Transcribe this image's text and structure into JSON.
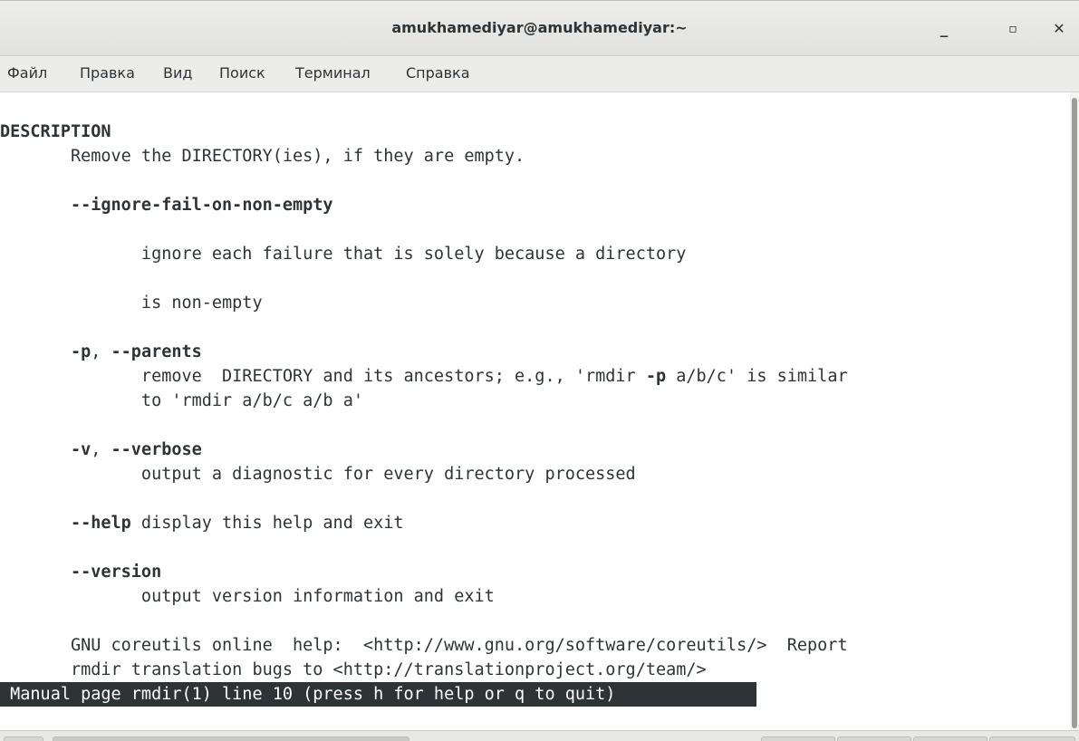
{
  "window": {
    "title": "amukhamediyar@amukhamediyar:~",
    "controls": {
      "minimize": "_",
      "maximize": "▫",
      "close": "✕"
    }
  },
  "menu": {
    "items": [
      "Файл",
      "Правка",
      "Вид",
      "Поиск",
      "Терминал",
      "Справка"
    ]
  },
  "terminal": {
    "lines": {
      "l1": "DESCRIPTION",
      "l2": "       Remove the DIRECTORY(ies), if they are empty.",
      "l3_opt": "--ignore-fail-on-non-empty",
      "l4": "              ignore each failure that is solely because a directory",
      "l5": "              is non-empty",
      "l6_opt1": "-p",
      "l6_sep": ", ",
      "l6_opt2": "--parents",
      "l7_pre": "              remove  DIRECTORY and its ancestors; e.g., 'rmdir ",
      "l7_bold": "-p",
      "l7_post": " a/b/c' is similar",
      "l8": "              to 'rmdir a/b/c a/b a'",
      "l9_opt1": "-v",
      "l9_sep": ", ",
      "l9_opt2": "--verbose",
      "l10": "              output a diagnostic for every directory processed",
      "l11_opt": "--help",
      "l11_text": " display this help and exit",
      "l12_opt": "--version",
      "l13": "              output version information and exit",
      "l14": "       GNU coreutils online  help:  <http://www.gnu.org/software/coreutils/>  Report",
      "l15": "       rmdir translation bugs to <http://translationproject.org/team/>"
    },
    "indent": "       ",
    "status": " Manual page rmdir(1) line 10 (press h for help or q to quit) "
  }
}
